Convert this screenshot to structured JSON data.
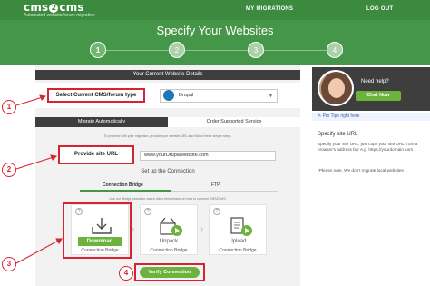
{
  "header": {
    "logo_left": "cms",
    "logo_mid": "2",
    "logo_right": "cms",
    "logo_sub": "Automated website/forum migration",
    "nav_migrations": "MY MIGRATIONS",
    "nav_logout": "LOG OUT"
  },
  "hero": {
    "title": "Specify Your Websites",
    "steps": [
      "1",
      "2",
      "3",
      "4"
    ]
  },
  "panel": {
    "details_title": "Your Current Website Details",
    "select_label": "Select Current CMS/forum type",
    "select_value": "Drupal",
    "tab_auto": "Migrate Automatically",
    "tab_order": "Order Supported Service",
    "proceed_text": "To proceed with your migration, provide your website URL and follow these simple steps.",
    "url_label": "Provide site URL",
    "url_value": "www.yourDrupalwebsite.com",
    "setup_title": "Set up the Connection",
    "subtab_bridge": "Connection Bridge",
    "subtab_ftp": "FTP",
    "instructions": "Use our Bridge tutorial or watch video beforehand on how to connect CMS2CMS.",
    "cards": [
      {
        "button": "Download",
        "caption": "Connection Bridge"
      },
      {
        "button": "Unpack",
        "caption": "Connection Bridge"
      },
      {
        "button": "Upload",
        "caption": "Connection Bridge"
      }
    ],
    "verify": "Verify Connection"
  },
  "annotations": [
    "1",
    "2",
    "3",
    "4"
  ],
  "sidebar": {
    "need_help": "Need help?",
    "chat": "Chat Now",
    "pro_tips": "Pro Tips right here",
    "tip_title": "Specify site URL",
    "tip_text": "Specify your site URL, just copy your site URL from a browser's address bar e.g. https://yourdomain.com",
    "tip_note": "*Please note, We don't migrate local websites"
  },
  "colors": {
    "brand_green": "#46964a",
    "button_green": "#6cb33e",
    "annotation_red": "#d8222f",
    "dark_bar": "#3e3e3e"
  }
}
